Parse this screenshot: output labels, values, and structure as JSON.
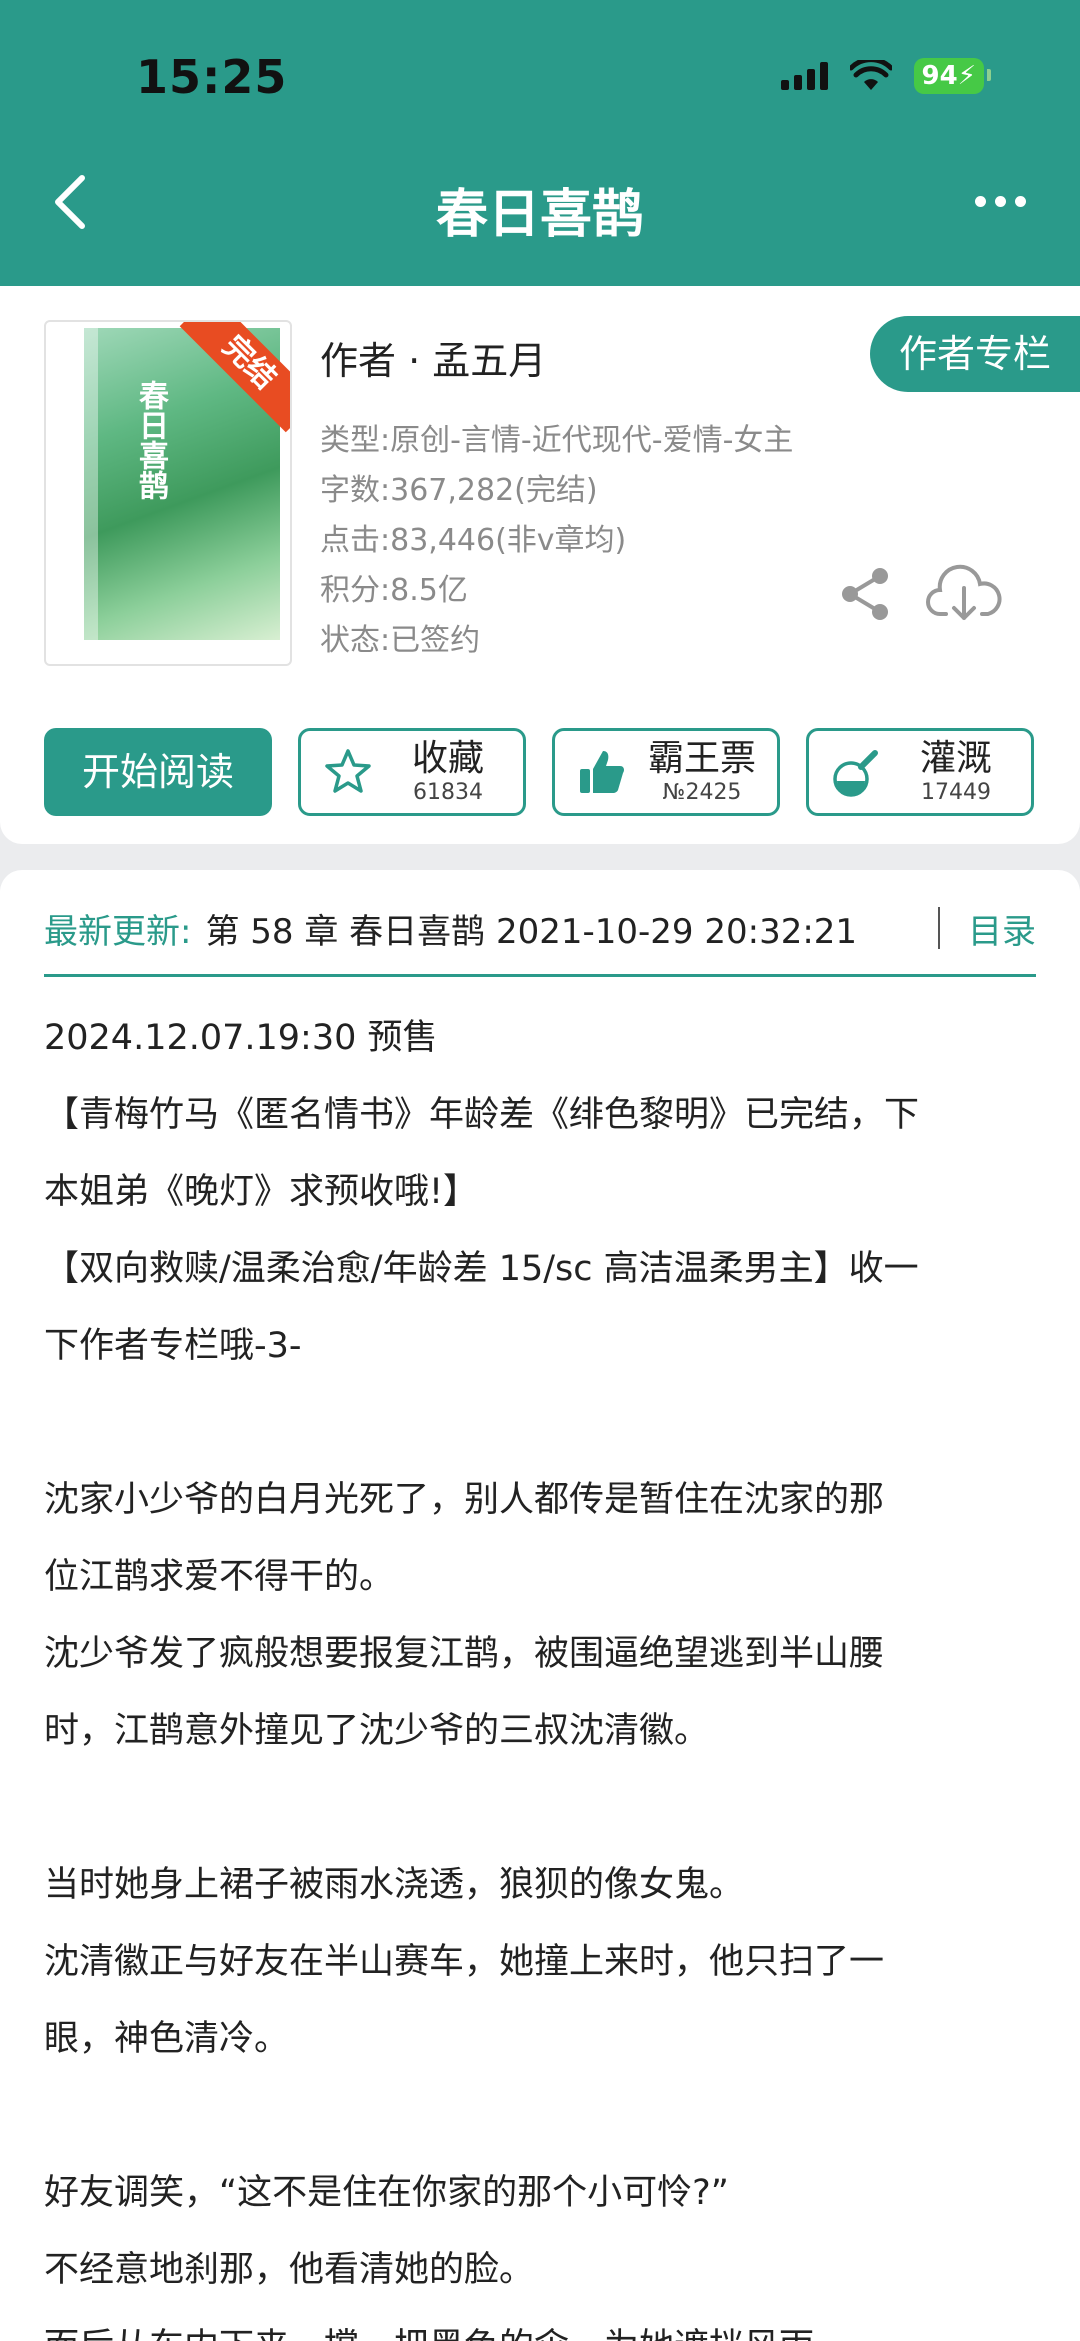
{
  "status": {
    "time": "15:25",
    "battery": "94"
  },
  "nav": {
    "title": "春日喜鹊"
  },
  "book": {
    "cover_title": "春日喜鹊",
    "badge": "完结",
    "author": "作者 · 孟五月",
    "author_column_label": "作者专栏",
    "meta": [
      "类型:原创-言情-近代现代-爱情-女主",
      "字数:367,282(完结)",
      "点击:83,446(非v章均)",
      "积分:8.5亿",
      "状态:已签约"
    ]
  },
  "actions": {
    "read_label": "开始阅读",
    "collect": {
      "label": "收藏",
      "count": "61834"
    },
    "ticket": {
      "label": "霸王票",
      "count": "№2425"
    },
    "water": {
      "label": "灌溉",
      "count": "17449"
    }
  },
  "update": {
    "label": "最新更新:",
    "text": "第 58 章 春日喜鹊 2021-10-29 20:32:21",
    "toc_label": "目录"
  },
  "description": [
    "2024.12.07.19:30 预售",
    "【青梅竹马《匿名情书》年龄差《绯色黎明》已完结，下",
    "本姐弟《晚灯》求预收哦!】",
    "【双向救赎/温柔治愈/年龄差 15/sc 高洁温柔男主】收一",
    "下作者专栏哦-3-",
    "",
    "沈家小少爷的白月光死了，别人都传是暂住在沈家的那",
    "位江鹊求爱不得干的。",
    "沈少爷发了疯般想要报复江鹊，被围逼绝望逃到半山腰",
    "时，江鹊意外撞见了沈少爷的三叔沈清徽。",
    "",
    "当时她身上裙子被雨水浇透，狼狈的像女鬼。",
    "沈清徽正与好友在半山赛车，她撞上来时，他只扫了一",
    "眼，神色清冷。",
    "",
    "好友调笑，“这不是住在你家的那个小可怜?”",
    "不经意地刹那，他看清她的脸。",
    "而后从车内下来，撑一把黑色的伞，为她遮挡风雨。"
  ]
}
